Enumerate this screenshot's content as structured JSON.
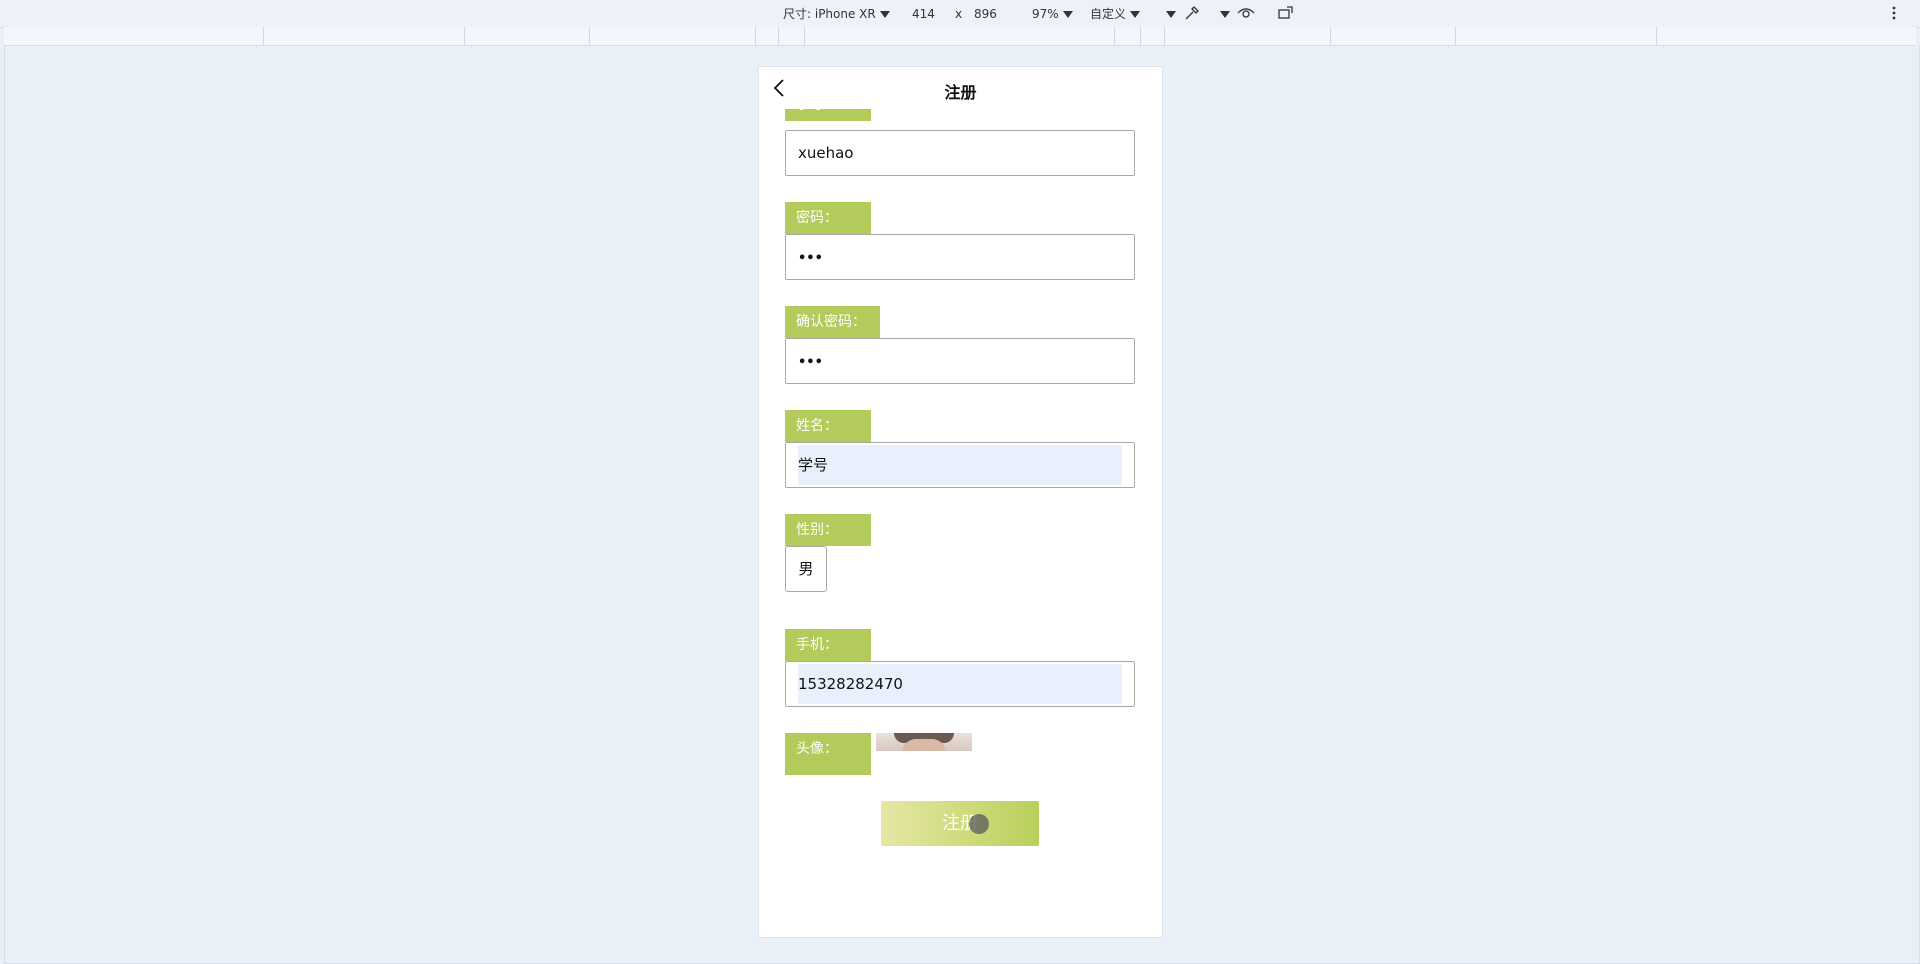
{
  "devtools": {
    "device_label": "尺寸: iPhone XR",
    "width": "414",
    "times": "x",
    "height": "896",
    "zoom": "97%",
    "throttle": "自定义"
  },
  "page": {
    "title": "注册",
    "fields": {
      "xuehao_label": "学号：",
      "xuehao_value": "xuehao",
      "password_label": "密码：",
      "password_value": "•••",
      "confirm_label": "确认密码：",
      "confirm_value": "•••",
      "name_label": "姓名：",
      "name_value": "学号",
      "gender_label": "性别：",
      "gender_value": "男",
      "phone_label": "手机：",
      "phone_value": "15328282470",
      "avatar_label": "头像："
    },
    "submit_label": "注册"
  },
  "colors": {
    "label_bg": "#b3cb5b",
    "autofill_bg": "#e8f0fe",
    "page_bg": "#eaf0f8"
  }
}
